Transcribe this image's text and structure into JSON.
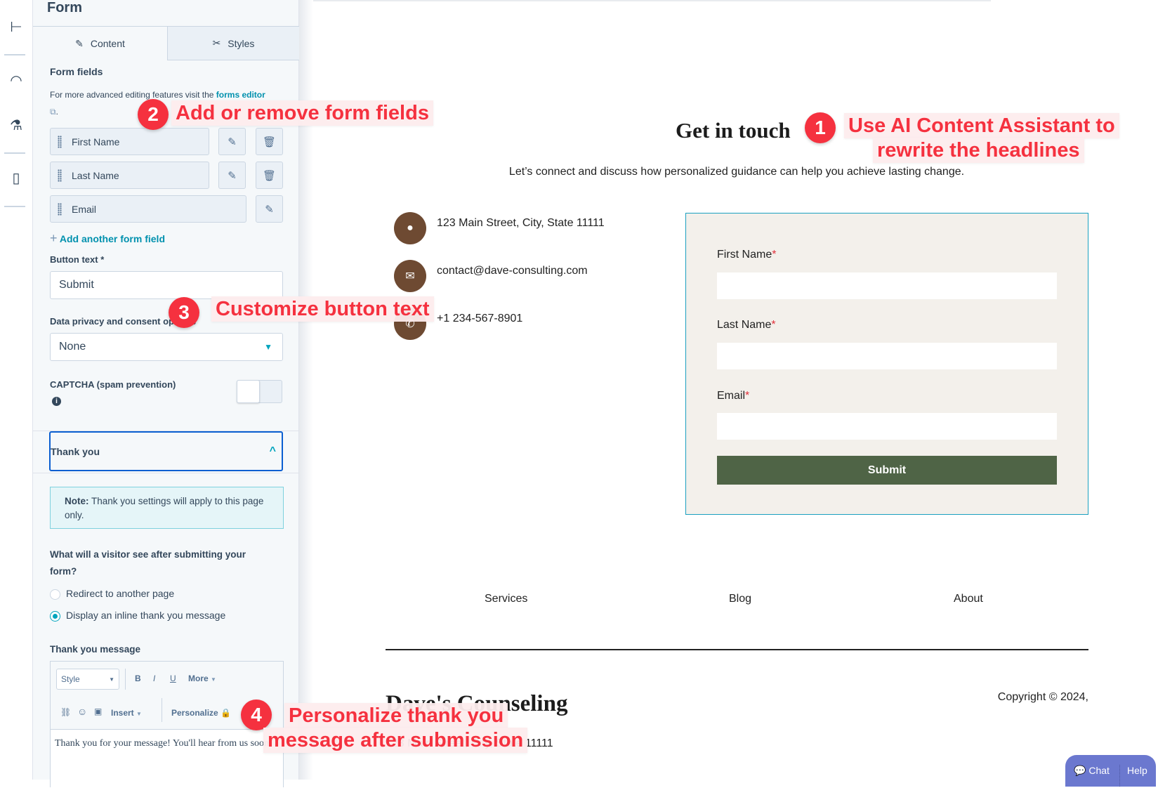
{
  "rail": {
    "icons": [
      "tree-icon",
      "gauge-icon",
      "flask-icon",
      "page-icon"
    ]
  },
  "panel": {
    "title": "Form",
    "tabs": [
      {
        "label": "Content",
        "icon": "pencil-icon",
        "active": true
      },
      {
        "label": "Styles",
        "icon": "brush-icon",
        "active": false
      }
    ],
    "form_fields_heading": "Form fields",
    "desc_prefix": "For more advanced editing features visit the ",
    "desc_link": "forms editor",
    "desc_suffix": ".",
    "fields": [
      {
        "label": "First Name",
        "deletable": true
      },
      {
        "label": "Last Name",
        "deletable": true
      },
      {
        "label": "Email",
        "deletable": false
      }
    ],
    "add_field": "Add another form field",
    "button_text_label": "Button text *",
    "button_text_value": "Submit",
    "privacy_label": "Data privacy and consent options",
    "privacy_value": "None",
    "captcha_label": "CAPTCHA (spam prevention)",
    "captcha_enabled": false,
    "thank_you_section": "Thank you",
    "note_bold": "Note:",
    "note_text": " Thank you settings will apply to this page only.",
    "question": "What will a visitor see after submitting your form?",
    "options": [
      {
        "label": "Redirect to another page",
        "selected": false
      },
      {
        "label": "Display an inline thank you message",
        "selected": true
      }
    ],
    "message_label": "Thank you message",
    "toolbar": {
      "style": "Style",
      "bold": "B",
      "italic": "I",
      "underline": "U",
      "more": "More",
      "insert": "Insert",
      "personalize": "Personalize"
    },
    "message_text": "Thank you for your message! You'll hear from us soon."
  },
  "preview": {
    "heading": "Get in touch",
    "subtitle": "Let’s connect and discuss how personalized guidance can help you achieve lasting change.",
    "contacts": [
      {
        "icon": "pin-icon",
        "text": "123 Main Street, City, State 11111"
      },
      {
        "icon": "envelope-icon",
        "text": "contact@dave-consulting.com"
      },
      {
        "icon": "phone-icon",
        "text": "+1 234-567-8901"
      }
    ],
    "form": {
      "fields": [
        "First Name",
        "Last Name",
        "Email"
      ],
      "required_mark": "*",
      "submit": "Submit",
      "submit_color": "#4f6446",
      "bg": "#f3f0eb"
    },
    "nav": [
      "Services",
      "Blog",
      "About"
    ],
    "footer_name": "Dave's Counseling",
    "footer_address": "123 Main Street, City, State 11111",
    "copyright": "Copyright © 2024,",
    "chat": "Chat",
    "help": "Help"
  },
  "annotations": [
    {
      "num": "1",
      "lines": [
        "Use AI Content Assistant to",
        "rewrite the headlines"
      ]
    },
    {
      "num": "2",
      "lines": [
        "Add or remove form fields"
      ]
    },
    {
      "num": "3",
      "lines": [
        "Customize button text"
      ]
    },
    {
      "num": "4",
      "lines": [
        "Personalize thank you",
        "message after submission"
      ]
    }
  ],
  "colors": {
    "annotation": "#f5313f",
    "accent": "#0091ae",
    "icon_bg": "#6e4a32",
    "chat": "#6b78cf"
  }
}
